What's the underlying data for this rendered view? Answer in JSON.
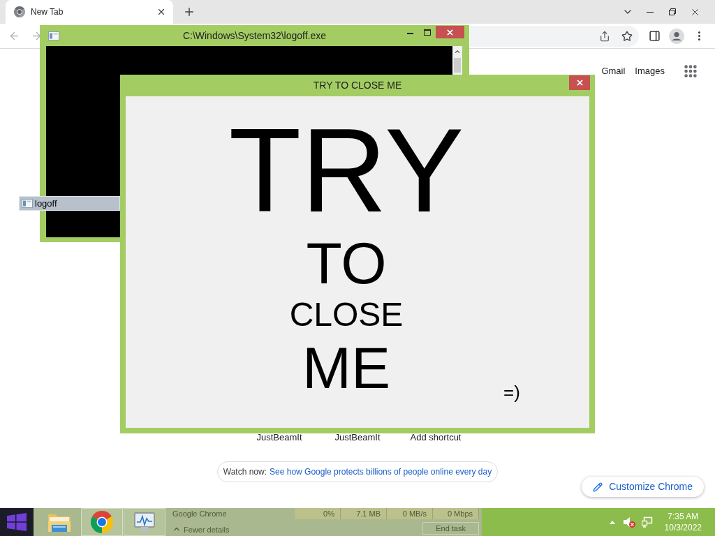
{
  "browser": {
    "tabs": [
      {
        "title": "New Tab",
        "selected": true
      }
    ],
    "header_links": [
      "Gmail",
      "Images"
    ],
    "shortcuts": [
      {
        "label": "JustBeamIt"
      },
      {
        "label": "JustBeamIt"
      },
      {
        "label": "Add shortcut"
      }
    ],
    "promo": {
      "label": "Watch now:",
      "link": "See how Google protects billions of people online every day"
    },
    "customize_button": "Customize Chrome"
  },
  "windows": [
    {
      "kind": "console",
      "title": "C:\\Windows\\System32\\logoff.exe"
    },
    {
      "kind": "message",
      "title": "TRY TO CLOSE ME",
      "lines": [
        "TRY",
        "TO",
        "CLOSE",
        "ME"
      ],
      "note": "=)"
    }
  ],
  "drag_item": {
    "label": "logoff"
  },
  "taskbar": {
    "apps": [
      {
        "kind": "folder",
        "running": false
      },
      {
        "kind": "chrome",
        "running": true
      },
      {
        "kind": "monitor",
        "running": true
      }
    ],
    "task_manager": {
      "process": "Google Chrome",
      "cells": [
        "0%",
        "7.1 MB",
        "0 MB/s",
        "0 Mbps"
      ],
      "toggle": "Fewer details",
      "end_task": "End task"
    },
    "clock": {
      "time": "7:35 AM",
      "date": "10/3/2022"
    }
  }
}
